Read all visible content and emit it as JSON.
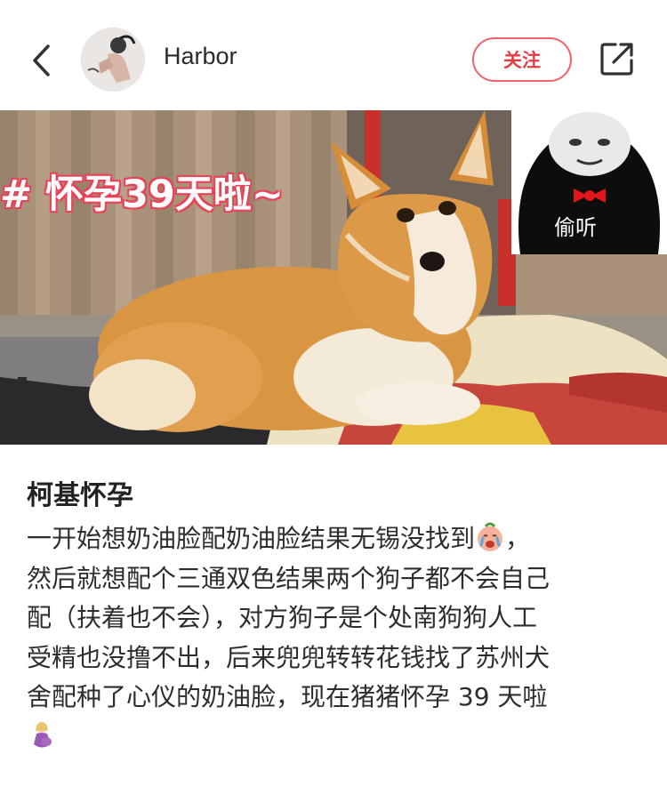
{
  "header": {
    "back_icon": "chevron-left-icon",
    "username": "Harbor",
    "follow_label": "关注",
    "share_icon": "share-out-icon",
    "accent_color": "#ea3a44"
  },
  "photo": {
    "overlay_text": "# 怀孕39天啦~",
    "meme_caption": "偷听"
  },
  "post": {
    "title": "柯基怀孕",
    "lines": [
      "一开始想奶油脸配奶油脸结果无锡没找到",
      "，",
      "然后就想配个三通双色结果两个狗子都不会自己",
      "配（扶着也不会），对方狗子是个处南狗狗人工",
      "受精也没撸不出，后来兜兜转转花钱找了苏州犬",
      "舍配种了心仪的奶油脸，现在猪猪怀孕 39 天啦"
    ],
    "emoji_1": "crying-baby-emoji",
    "emoji_2": "pregnant-woman-emoji"
  }
}
